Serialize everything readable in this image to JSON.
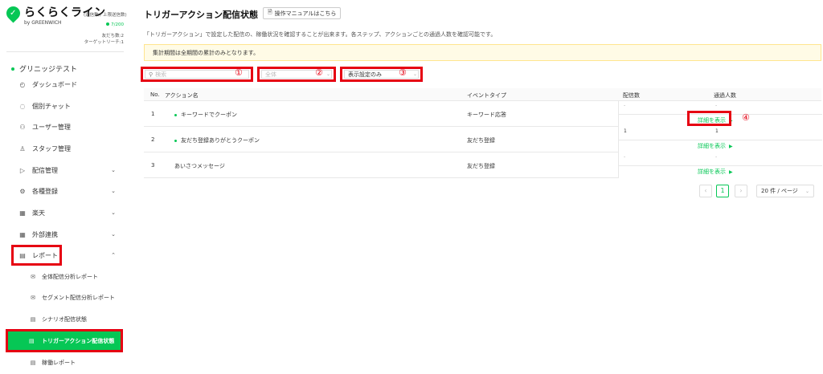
{
  "brand": {
    "title": "らくらくライン",
    "by": "by GREENWICH",
    "badge": "(送信数 / 上限送信数)",
    "send_count": "7/200",
    "friends": "友だち数:2",
    "targets": "ターゲットリーチ:1"
  },
  "sidebar": {
    "account": "グリニッジテスト",
    "items": [
      {
        "label": "ダッシュボード",
        "icon": "gauge-icon"
      },
      {
        "label": "個別チャット",
        "icon": "chat-icon"
      },
      {
        "label": "ユーザー管理",
        "icon": "users-icon"
      },
      {
        "label": "スタッフ管理",
        "icon": "person-icon"
      },
      {
        "label": "配信管理",
        "icon": "send-icon",
        "expand": "down"
      },
      {
        "label": "各種登録",
        "icon": "gear-icon",
        "expand": "down"
      },
      {
        "label": "楽天",
        "icon": "store-icon",
        "expand": "down"
      },
      {
        "label": "外部連携",
        "icon": "link-icon",
        "expand": "down"
      },
      {
        "label": "レポート",
        "icon": "report-icon",
        "expand": "up"
      }
    ],
    "sub_items": [
      {
        "label": "全体配信分析レポート",
        "icon": "mail-icon"
      },
      {
        "label": "セグメント配信分析レポート",
        "icon": "mail-icon"
      },
      {
        "label": "シナリオ配信状態",
        "icon": "doc-icon"
      },
      {
        "label": "トリガーアクション配信状態",
        "icon": "doc-icon"
      },
      {
        "label": "稼働レポート",
        "icon": "doc-icon"
      }
    ]
  },
  "main": {
    "title": "トリガーアクション配信状態",
    "manual_button": "操作マニュアルはこちら",
    "description": "「トリガーアクション」で設定した配信の、稼働状況を確認することが出来ます。各ステップ、アクションごとの通過人数を確認可能です。",
    "notice": "集計期間は全期間の累計のみとなります。",
    "filters": {
      "search_placeholder": "検索",
      "event_select": "全体",
      "display_select": "表示設定のみ"
    },
    "marks": [
      "①",
      "②",
      "③",
      "④"
    ],
    "table": {
      "headers": [
        "No.",
        "アクション名",
        "イベントタイプ",
        "配信数",
        "通過人数"
      ],
      "rows": [
        {
          "no": "1",
          "name": "キーワードでクーポン",
          "event": "キーワード応答",
          "sent": "-",
          "passed": "-",
          "detail": "詳細を表示",
          "dot": true
        },
        {
          "no": "2",
          "name": "友だち登録ありがとうクーポン",
          "event": "友だち登録",
          "sent": "1",
          "passed": "1",
          "detail": "詳細を表示",
          "dot": true
        },
        {
          "no": "3",
          "name": "あいさつメッセージ",
          "event": "友だち登録",
          "sent": "-",
          "passed": "-",
          "detail": "詳細を表示",
          "dot": false
        }
      ]
    },
    "pagination": {
      "prev": "‹",
      "current": "1",
      "next": "›",
      "per_page": "20 件 / ページ"
    }
  },
  "colors": {
    "accent": "#06c755",
    "highlight": "#e60012"
  }
}
